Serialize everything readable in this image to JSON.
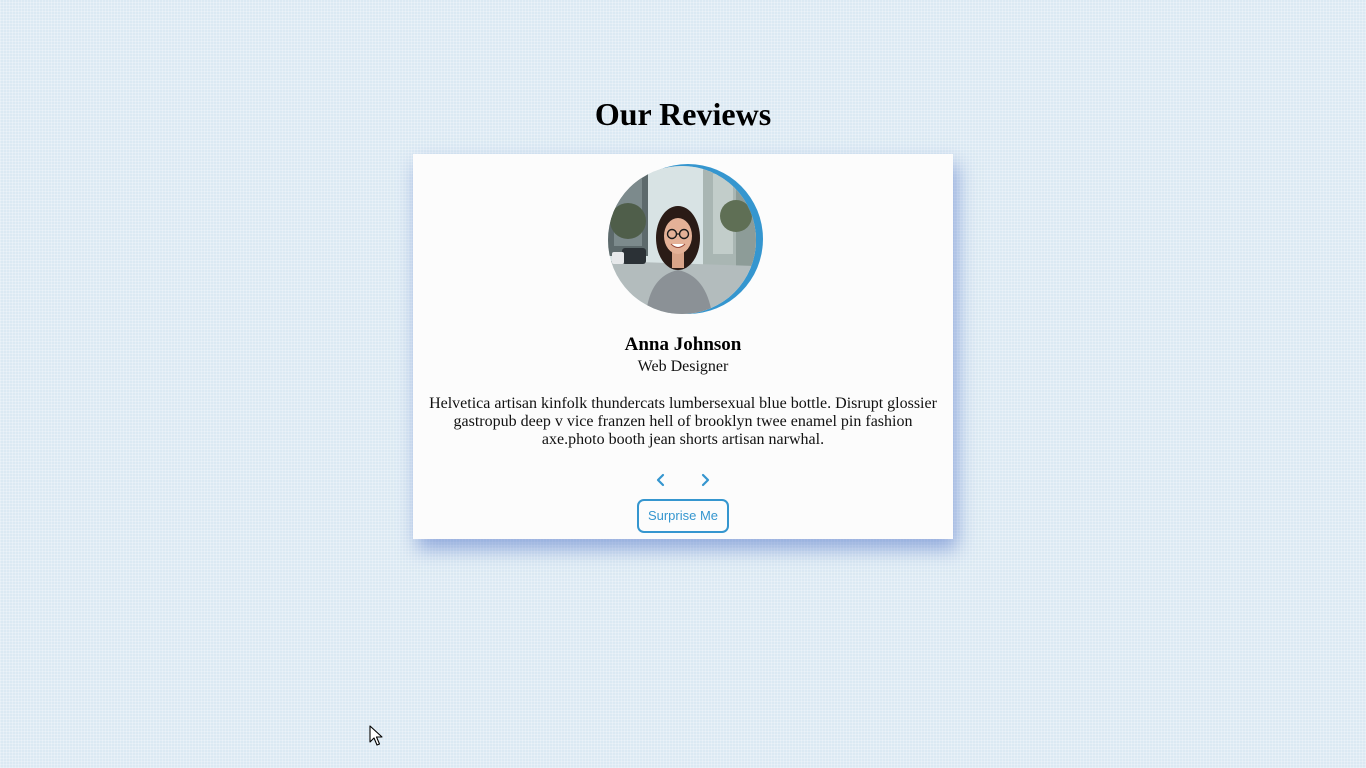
{
  "page": {
    "title": "Our Reviews"
  },
  "review": {
    "name": "Anna Johnson",
    "job": "Web Designer",
    "text": "Helvetica artisan kinfolk thundercats lumbersexual blue bottle. Disrupt glossier gastropub deep v vice franzen hell of brooklyn twee enamel pin fashion axe.photo booth jean shorts artisan narwhal."
  },
  "controls": {
    "prev_icon": "chevron-left-icon",
    "next_icon": "chevron-right-icon",
    "surprise_label": "Surprise Me"
  },
  "colors": {
    "accent": "#3596cf",
    "background": "#dbe9f3",
    "card": "#fcfcfc"
  }
}
